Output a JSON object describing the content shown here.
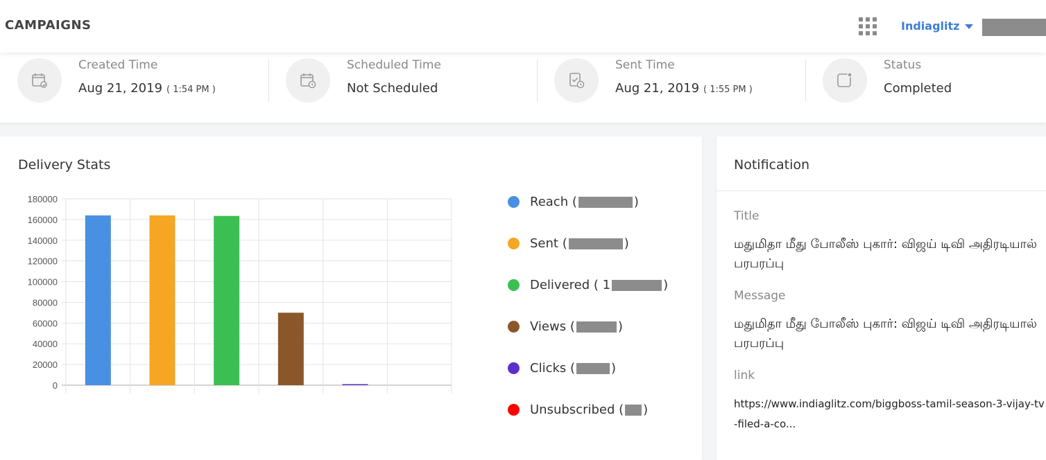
{
  "header": {
    "title": "CAMPAIGNS",
    "account_name": "Indiaglitz"
  },
  "times": [
    {
      "label": "Created Time",
      "value": "Aug 21, 2019",
      "sub": "( 1:54 PM )",
      "icon": "calendar-edit-icon"
    },
    {
      "label": "Scheduled Time",
      "value": "Not Scheduled",
      "sub": "",
      "icon": "calendar-clock-icon"
    },
    {
      "label": "Sent Time",
      "value": "Aug 21, 2019",
      "sub": "( 1:55 PM )",
      "icon": "doc-check-clock-icon"
    },
    {
      "label": "Status",
      "value": "Completed",
      "sub": "",
      "icon": "status-icon"
    }
  ],
  "stats": {
    "title": "Delivery Stats"
  },
  "chart_data": {
    "type": "bar",
    "categories": [
      "Reach",
      "Sent",
      "Delivered",
      "Views",
      "Clicks",
      "Unsubscribed"
    ],
    "values": [
      164000,
      164000,
      163500,
      70000,
      1000,
      0
    ],
    "colors": [
      "#4a90e2",
      "#f5a623",
      "#3cbf52",
      "#8b572a",
      "#5b2fc9",
      "#ff0000"
    ],
    "ylim": [
      0,
      180000
    ],
    "yticks": [
      "0",
      "20000",
      "40000",
      "60000",
      "80000",
      "100000",
      "120000",
      "140000",
      "160000",
      "180000"
    ],
    "grid": true,
    "legend_position": "right"
  },
  "legend": [
    {
      "label": "Reach (",
      "tail": ")",
      "color": "#4a90e2"
    },
    {
      "label": "Sent ( ",
      "tail": ")",
      "color": "#f5a623"
    },
    {
      "label": "Delivered ( 1",
      "tail": ")",
      "color": "#3cbf52"
    },
    {
      "label": "Views (",
      "tail": " )",
      "color": "#8b572a"
    },
    {
      "label": "Clicks (",
      "tail": " )",
      "color": "#5b2fc9"
    },
    {
      "label": "Unsubscribed (",
      "tail": " )",
      "color": "#ff0000"
    }
  ],
  "notification": {
    "panel_title": "Notification",
    "title_label": "Title",
    "title_text": "மதுமிதா மீது போலீஸ் புகார்: விஜய் டிவி அதிரடியால் பரபரப்பு",
    "message_label": "Message",
    "message_text": "மதுமிதா மீது போலீஸ் புகார்: விஜய் டிவி அதிரடியால் பரபரப்பு",
    "link_label": "link",
    "link_text": "https://www.indiaglitz.com/biggboss-tamil-season-3-vijay-tv-filed-a-co..."
  }
}
